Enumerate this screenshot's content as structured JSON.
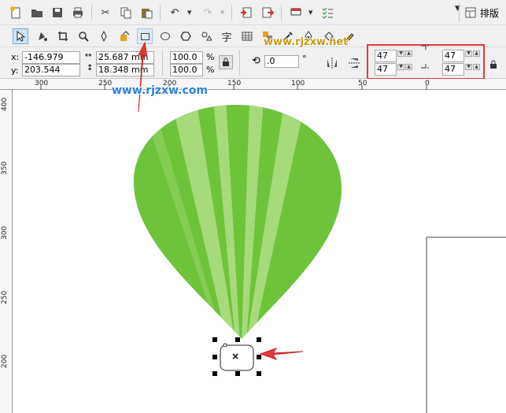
{
  "toolbar": {
    "layout_label": "排版"
  },
  "tools": {
    "text_tool_glyph": "字"
  },
  "properties": {
    "x_label": "x:",
    "x_value": "-146.979 mm",
    "y_label": "y:",
    "y_value": "203.544 mm",
    "width_value": "25.687 mm",
    "height_value": "18.348 mm",
    "scale_x": "100.0",
    "scale_y": "100.0",
    "percent": "%",
    "rotation_value": ".0",
    "degree": "°",
    "corner_top_left": "47",
    "corner_bottom_left": "47",
    "corner_top_right": "47",
    "corner_bottom_right": "47"
  },
  "ruler_top": [
    "300",
    "250",
    "200",
    "150",
    "100",
    "50",
    "0"
  ],
  "ruler_left": [
    "400",
    "350",
    "300",
    "250",
    "200"
  ],
  "watermarks": {
    "top": "www.rjzxw.net",
    "left": "www.rjzxw.com"
  },
  "selection_marker": "×",
  "colors": {
    "balloon_dark": "#6dc33a",
    "balloon_light": "#a6db7c",
    "highlight_box": "#e03c3c",
    "arrow": "#e53a3a"
  }
}
